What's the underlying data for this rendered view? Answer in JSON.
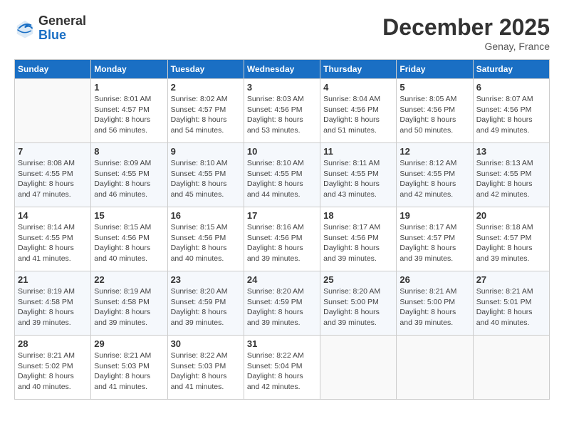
{
  "header": {
    "logo_line1": "General",
    "logo_line2": "Blue",
    "month": "December 2025",
    "location": "Genay, France"
  },
  "days_of_week": [
    "Sunday",
    "Monday",
    "Tuesday",
    "Wednesday",
    "Thursday",
    "Friday",
    "Saturday"
  ],
  "weeks": [
    [
      {
        "day": "",
        "sunrise": "",
        "sunset": "",
        "daylight": ""
      },
      {
        "day": "1",
        "sunrise": "8:01 AM",
        "sunset": "4:57 PM",
        "daylight": "8 hours and 56 minutes."
      },
      {
        "day": "2",
        "sunrise": "8:02 AM",
        "sunset": "4:57 PM",
        "daylight": "8 hours and 54 minutes."
      },
      {
        "day": "3",
        "sunrise": "8:03 AM",
        "sunset": "4:56 PM",
        "daylight": "8 hours and 53 minutes."
      },
      {
        "day": "4",
        "sunrise": "8:04 AM",
        "sunset": "4:56 PM",
        "daylight": "8 hours and 51 minutes."
      },
      {
        "day": "5",
        "sunrise": "8:05 AM",
        "sunset": "4:56 PM",
        "daylight": "8 hours and 50 minutes."
      },
      {
        "day": "6",
        "sunrise": "8:07 AM",
        "sunset": "4:56 PM",
        "daylight": "8 hours and 49 minutes."
      }
    ],
    [
      {
        "day": "7",
        "sunrise": "8:08 AM",
        "sunset": "4:55 PM",
        "daylight": "8 hours and 47 minutes."
      },
      {
        "day": "8",
        "sunrise": "8:09 AM",
        "sunset": "4:55 PM",
        "daylight": "8 hours and 46 minutes."
      },
      {
        "day": "9",
        "sunrise": "8:10 AM",
        "sunset": "4:55 PM",
        "daylight": "8 hours and 45 minutes."
      },
      {
        "day": "10",
        "sunrise": "8:10 AM",
        "sunset": "4:55 PM",
        "daylight": "8 hours and 44 minutes."
      },
      {
        "day": "11",
        "sunrise": "8:11 AM",
        "sunset": "4:55 PM",
        "daylight": "8 hours and 43 minutes."
      },
      {
        "day": "12",
        "sunrise": "8:12 AM",
        "sunset": "4:55 PM",
        "daylight": "8 hours and 42 minutes."
      },
      {
        "day": "13",
        "sunrise": "8:13 AM",
        "sunset": "4:55 PM",
        "daylight": "8 hours and 42 minutes."
      }
    ],
    [
      {
        "day": "14",
        "sunrise": "8:14 AM",
        "sunset": "4:55 PM",
        "daylight": "8 hours and 41 minutes."
      },
      {
        "day": "15",
        "sunrise": "8:15 AM",
        "sunset": "4:56 PM",
        "daylight": "8 hours and 40 minutes."
      },
      {
        "day": "16",
        "sunrise": "8:15 AM",
        "sunset": "4:56 PM",
        "daylight": "8 hours and 40 minutes."
      },
      {
        "day": "17",
        "sunrise": "8:16 AM",
        "sunset": "4:56 PM",
        "daylight": "8 hours and 39 minutes."
      },
      {
        "day": "18",
        "sunrise": "8:17 AM",
        "sunset": "4:56 PM",
        "daylight": "8 hours and 39 minutes."
      },
      {
        "day": "19",
        "sunrise": "8:17 AM",
        "sunset": "4:57 PM",
        "daylight": "8 hours and 39 minutes."
      },
      {
        "day": "20",
        "sunrise": "8:18 AM",
        "sunset": "4:57 PM",
        "daylight": "8 hours and 39 minutes."
      }
    ],
    [
      {
        "day": "21",
        "sunrise": "8:19 AM",
        "sunset": "4:58 PM",
        "daylight": "8 hours and 39 minutes."
      },
      {
        "day": "22",
        "sunrise": "8:19 AM",
        "sunset": "4:58 PM",
        "daylight": "8 hours and 39 minutes."
      },
      {
        "day": "23",
        "sunrise": "8:20 AM",
        "sunset": "4:59 PM",
        "daylight": "8 hours and 39 minutes."
      },
      {
        "day": "24",
        "sunrise": "8:20 AM",
        "sunset": "4:59 PM",
        "daylight": "8 hours and 39 minutes."
      },
      {
        "day": "25",
        "sunrise": "8:20 AM",
        "sunset": "5:00 PM",
        "daylight": "8 hours and 39 minutes."
      },
      {
        "day": "26",
        "sunrise": "8:21 AM",
        "sunset": "5:00 PM",
        "daylight": "8 hours and 39 minutes."
      },
      {
        "day": "27",
        "sunrise": "8:21 AM",
        "sunset": "5:01 PM",
        "daylight": "8 hours and 40 minutes."
      }
    ],
    [
      {
        "day": "28",
        "sunrise": "8:21 AM",
        "sunset": "5:02 PM",
        "daylight": "8 hours and 40 minutes."
      },
      {
        "day": "29",
        "sunrise": "8:21 AM",
        "sunset": "5:03 PM",
        "daylight": "8 hours and 41 minutes."
      },
      {
        "day": "30",
        "sunrise": "8:22 AM",
        "sunset": "5:03 PM",
        "daylight": "8 hours and 41 minutes."
      },
      {
        "day": "31",
        "sunrise": "8:22 AM",
        "sunset": "5:04 PM",
        "daylight": "8 hours and 42 minutes."
      },
      {
        "day": "",
        "sunrise": "",
        "sunset": "",
        "daylight": ""
      },
      {
        "day": "",
        "sunrise": "",
        "sunset": "",
        "daylight": ""
      },
      {
        "day": "",
        "sunrise": "",
        "sunset": "",
        "daylight": ""
      }
    ]
  ]
}
